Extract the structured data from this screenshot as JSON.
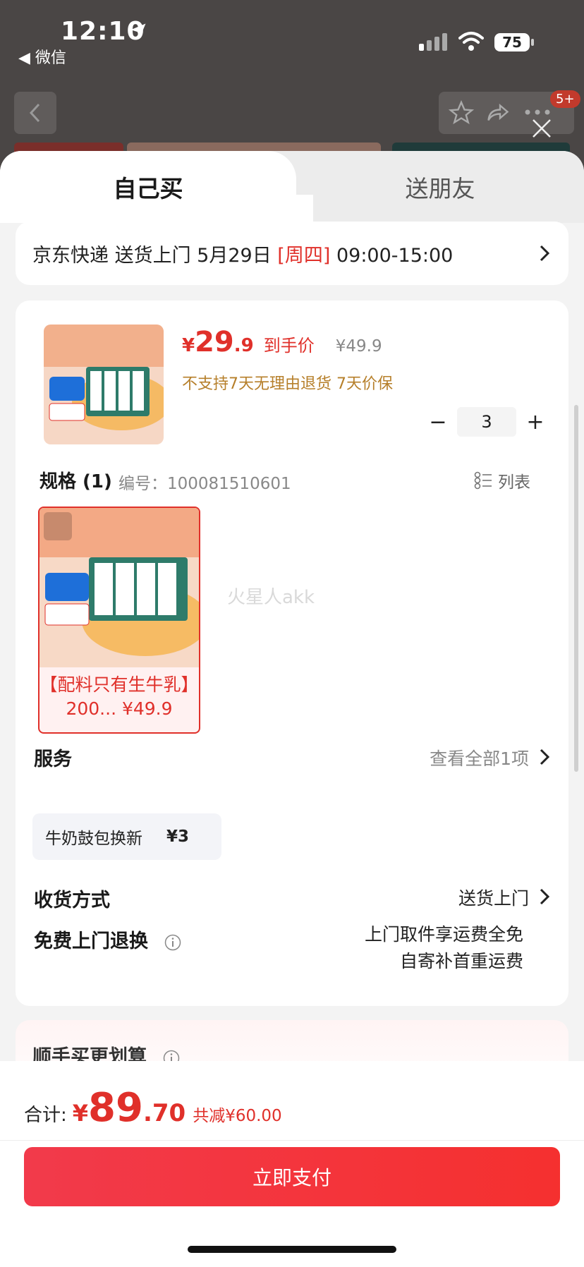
{
  "status_bar": {
    "time": "12:10",
    "back_app": "◀ 微信",
    "battery": "75"
  },
  "header": {
    "cart_badge": "5+"
  },
  "tabs": [
    {
      "label": "自己买",
      "active": true
    },
    {
      "label": "送朋友",
      "active": false
    }
  ],
  "delivery": {
    "prefix": "京东快递 送货上门 5月29日 ",
    "day": "[周四]",
    "time": " 09:00-15:00"
  },
  "product": {
    "price_symbol": "¥",
    "price_int": "29",
    "price_dec": ".9",
    "price_tag": "到手价",
    "original_price": "¥49.9",
    "policy": "不支持7天无理由退货  7天价保",
    "quantity": "3",
    "minus": "−",
    "plus": "+"
  },
  "spec": {
    "title": "规格 (1)",
    "code": "编号：100081510601",
    "list_label": "列表",
    "option_text": "【配料只有生牛乳】200... ¥49.9"
  },
  "watermark": "火星人akk",
  "service": {
    "title": "服务",
    "view_all": "查看全部1项",
    "item_name": "牛奶鼓包换新",
    "item_price": "¥3"
  },
  "shipping": {
    "title": "收货方式",
    "value": "送货上门"
  },
  "free_return": {
    "title": "免费上门退换",
    "line1": "上门取件享运费全免",
    "line2": "自寄补首重运费"
  },
  "extra": {
    "title": "顺手买更划算"
  },
  "footer": {
    "total_label": "合计:",
    "total_symbol": "¥",
    "total_int": "89",
    "total_dec": ".70",
    "discount": "共减¥60.00",
    "pay_label": "立即支付"
  },
  "colors": {
    "accent": "#e0302a",
    "gold": "#b67f2a"
  }
}
